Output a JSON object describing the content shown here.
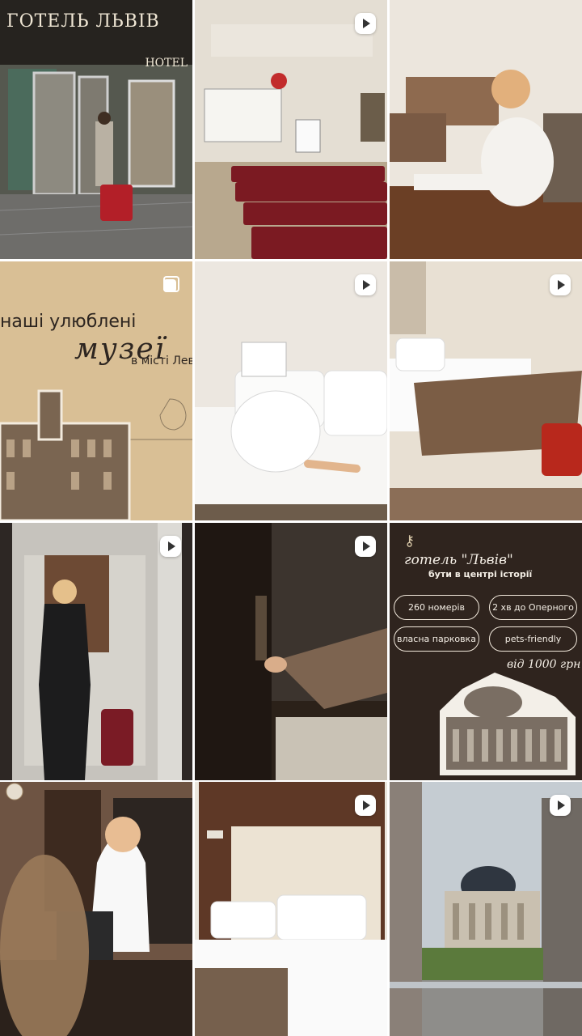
{
  "tiles": {
    "t1": {
      "sign_main": "ГОТЕЛЬ ЛЬВІВ",
      "sign_hotel": "HOTEL"
    },
    "t4": {
      "line1": "наші улюблені",
      "line2": "музеї",
      "line3": "в місті Лев"
    },
    "t9": {
      "title": "готель \"Львів\"",
      "subtitle": "бути в центрі історії",
      "pill1": "260 номерів",
      "pill2": "2 хв до Оперного",
      "pill3": "власна парковка",
      "pill4": "pets-friendly",
      "price": "від 1000 грн"
    }
  },
  "icons": {
    "video": "play-icon",
    "carousel": "carousel-icon"
  },
  "colors": {
    "beige": "#d9bf95",
    "dark_brown": "#2f241e",
    "cream": "#f5efe6"
  }
}
